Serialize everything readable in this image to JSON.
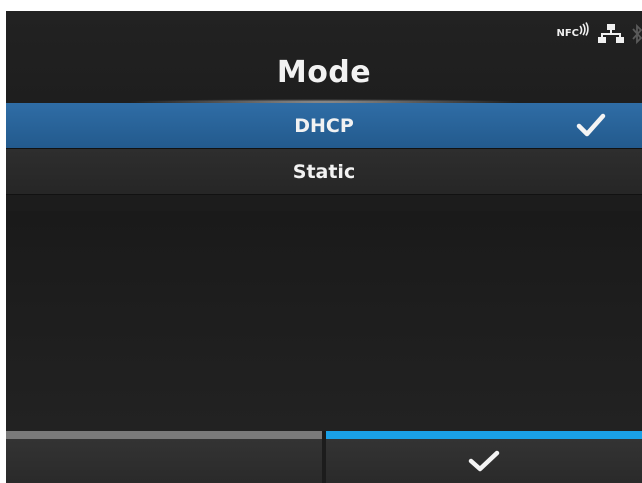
{
  "header": {
    "title": "Mode",
    "status": {
      "nfc_label": "NFC",
      "icons": [
        "nfc-icon",
        "network-icon",
        "bluetooth-icon"
      ]
    }
  },
  "options": [
    {
      "label": "DHCP",
      "selected": true
    },
    {
      "label": "Static",
      "selected": false
    }
  ],
  "softkeys": {
    "left": {
      "label": "",
      "bar_color": "#7a7a7a"
    },
    "right": {
      "icon": "check-icon",
      "bar_color": "#1aa0e6"
    }
  },
  "colors": {
    "selected_row": "#2a6398",
    "accent": "#1aa0e6",
    "background": "#1c1c1c"
  }
}
